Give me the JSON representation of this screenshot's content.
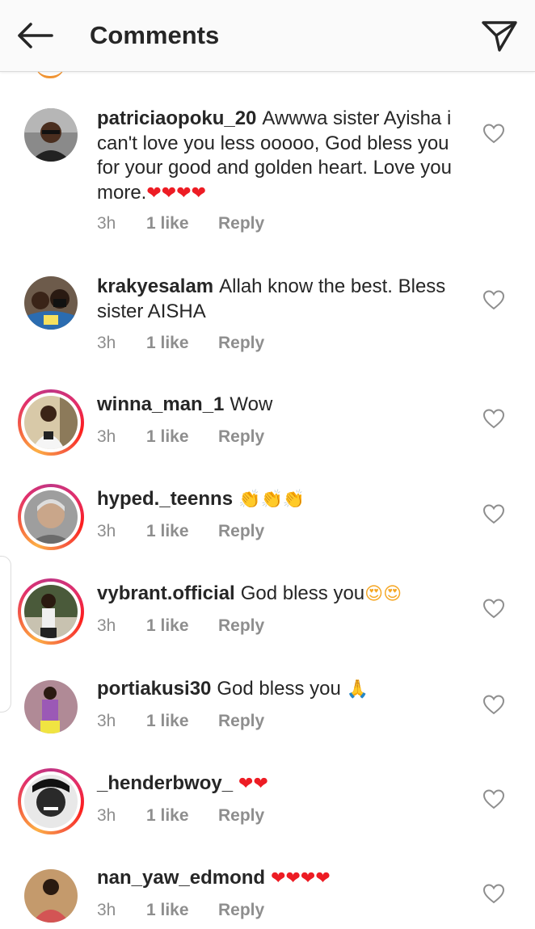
{
  "header": {
    "title": "Comments"
  },
  "comments": [
    {
      "username": "patriciaopoku_20",
      "text": "Awwwa sister Ayisha i can't love you less ooooo, God bless you for your good and golden heart. Love you more.",
      "emoji": "❤❤❤❤",
      "time": "3h",
      "likes": "1 like",
      "reply": "Reply",
      "story_ring": false
    },
    {
      "username": "krakyesalam",
      "text": "Allah know the best. Bless sister AISHA",
      "emoji": "",
      "time": "3h",
      "likes": "1 like",
      "reply": "Reply",
      "story_ring": false
    },
    {
      "username": "winna_man_1",
      "text": "Wow",
      "emoji": "",
      "time": "3h",
      "likes": "1 like",
      "reply": "Reply",
      "story_ring": true
    },
    {
      "username": "hyped._teenns",
      "text": "",
      "emoji": "👏👏👏",
      "time": "3h",
      "likes": "1 like",
      "reply": "Reply",
      "story_ring": true
    },
    {
      "username": "vybrant.official",
      "text": "God bless you",
      "emoji": "😍😍",
      "time": "3h",
      "likes": "1 like",
      "reply": "Reply",
      "story_ring": true
    },
    {
      "username": "portiakusi30",
      "text": "God bless you",
      "emoji": "🙏",
      "time": "3h",
      "likes": "1 like",
      "reply": "Reply",
      "story_ring": false
    },
    {
      "username": "_henderbwoy_",
      "text": "",
      "emoji": "❤❤",
      "time": "3h",
      "likes": "1 like",
      "reply": "Reply",
      "story_ring": true
    },
    {
      "username": "nan_yaw_edmond",
      "text": "",
      "emoji": "❤❤❤❤",
      "time": "3h",
      "likes": "1 like",
      "reply": "Reply",
      "story_ring": false
    }
  ]
}
